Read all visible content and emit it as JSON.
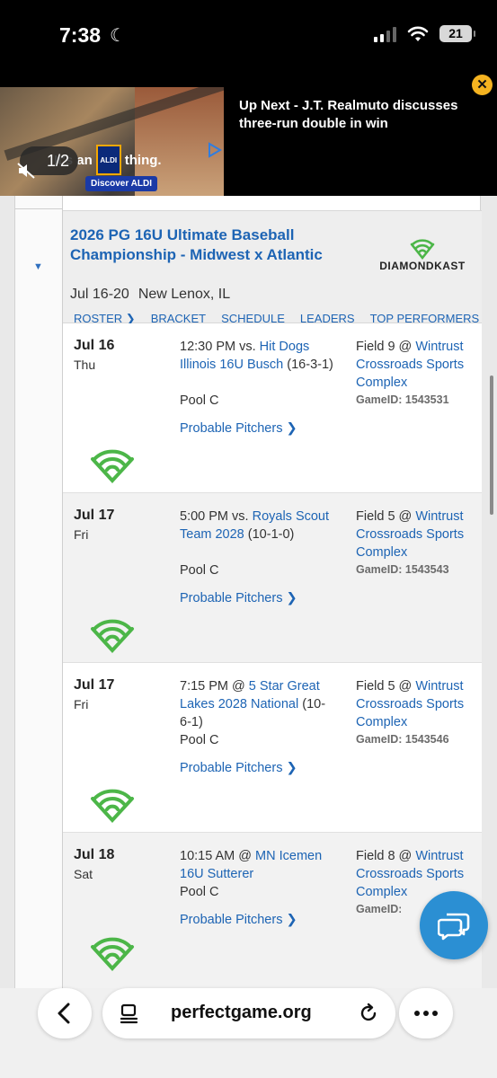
{
  "status_bar": {
    "time": "7:38",
    "battery": "21"
  },
  "ad": {
    "tagline_pre": "It's an",
    "brand": "ALDI",
    "tagline_post": "thing.",
    "cta": "Discover ALDI",
    "counter": "1/2",
    "up_next": "Up Next - J.T. Realmuto discusses three-run double in win"
  },
  "event": {
    "title": "2026 PG 16U Ultimate Baseball Championship - Midwest x Atlantic",
    "dates": "Jul 16-20",
    "location": "New Lenox, IL",
    "partner_logo": "DIAMONDKAST",
    "nav": [
      "ROSTER",
      "BRACKET",
      "SCHEDULE",
      "LEADERS",
      "TOP PERFORMERS"
    ]
  },
  "games": [
    {
      "date": "Jul 16",
      "day": "Thu",
      "time_prefix": "12:30 PM vs.",
      "opponent": "Hit Dogs Illinois 16U Busch",
      "record": "(16-3-1)",
      "pool": "Pool C",
      "pitchers": "Probable Pitchers",
      "field": "Field 9 @",
      "venue": "Wintrust Crossroads Sports Complex",
      "game_id": "GameID: 1543531"
    },
    {
      "date": "Jul 17",
      "day": "Fri",
      "time_prefix": "5:00 PM vs.",
      "opponent": "Royals Scout Team 2028",
      "record": "(10-1-0)",
      "pool": "Pool C",
      "pitchers": "Probable Pitchers",
      "field": "Field 5 @",
      "venue": "Wintrust Crossroads Sports Complex",
      "game_id": "GameID: 1543543"
    },
    {
      "date": "Jul 17",
      "day": "Fri",
      "time_prefix": "7:15 PM @",
      "opponent": "5 Star Great Lakes 2028 National",
      "record": "(10-6-1)",
      "pool": "Pool C",
      "pitchers": "Probable Pitchers",
      "field": "Field 5 @",
      "venue": "Wintrust Crossroads Sports Complex",
      "game_id": "GameID: 1543546"
    },
    {
      "date": "Jul 18",
      "day": "Sat",
      "time_prefix": "10:15 AM @",
      "opponent": "MN Icemen 16U Sutterer",
      "record": "",
      "pool": "Pool C",
      "pitchers": "Probable Pitchers",
      "field": "Field 8 @",
      "venue": "Wintrust Crossroads Sports Complex",
      "game_id": "GameID: 15"
    }
  ],
  "browser": {
    "url": "perfectgame.org"
  },
  "colors": {
    "link": "#1d64b4",
    "diamondkast_green": "#4cb648",
    "chat_button": "#2b8fd3"
  }
}
